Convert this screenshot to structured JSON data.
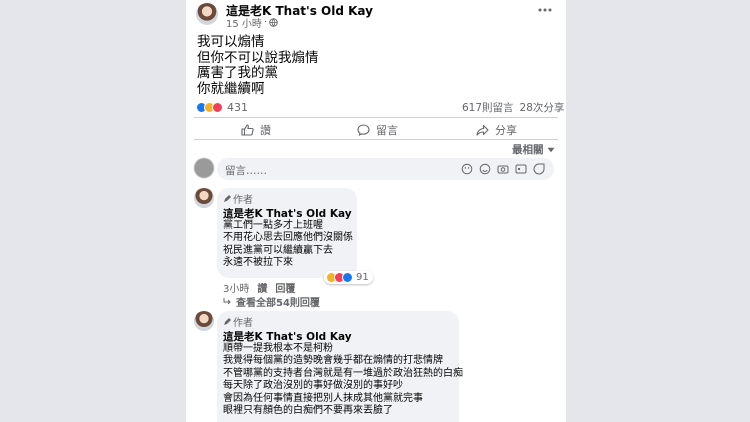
{
  "post": {
    "author": "這是老K That's Old Kay",
    "time": "15 小時",
    "lines": [
      "我可以煽情",
      "但你不可以說我煽情",
      "厲害了我的黨",
      "你就繼續啊"
    ],
    "reaction_count": "431",
    "comments_count": "617則留言",
    "shares_count": "28次分享"
  },
  "actions": {
    "like": "讚",
    "comment": "留言",
    "share": "分享"
  },
  "sort": {
    "label": "最相關"
  },
  "composer": {
    "placeholder": "留言……"
  },
  "comments": [
    {
      "badge": "作者",
      "author": "這是老K That's Old Kay",
      "lines": [
        "黨工們一點多才上班喔",
        "不用花心思去回應他們沒關係",
        "祝民進黨可以繼續贏下去",
        "永遠不被拉下來"
      ],
      "reaction_count": "91",
      "time": "3小時",
      "like": "讚",
      "reply": "回覆",
      "view_replies": "查看全部54則回覆"
    },
    {
      "badge": "作者",
      "author": "這是老K That's Old Kay",
      "lines": [
        "順帶一提我根本不是柯粉",
        "我覺得每個黨的造勢晚會幾乎都在煽情的打悲情牌",
        "不管哪黨的支持者台灣就是有一堆過於政治狂熱的白痴",
        "每天除了政治沒別的事好做沒別的事好吵",
        "會因為任何事情直接把別人抹成其他黨就完事",
        "眼裡只有顏色的白痴們不要再來丟臉了"
      ]
    }
  ],
  "colors": {
    "like_blue": "#1877f2",
    "love_red": "#f33e58",
    "haha_yellow": "#f7b125",
    "page_bg": "#e4e6eb"
  }
}
